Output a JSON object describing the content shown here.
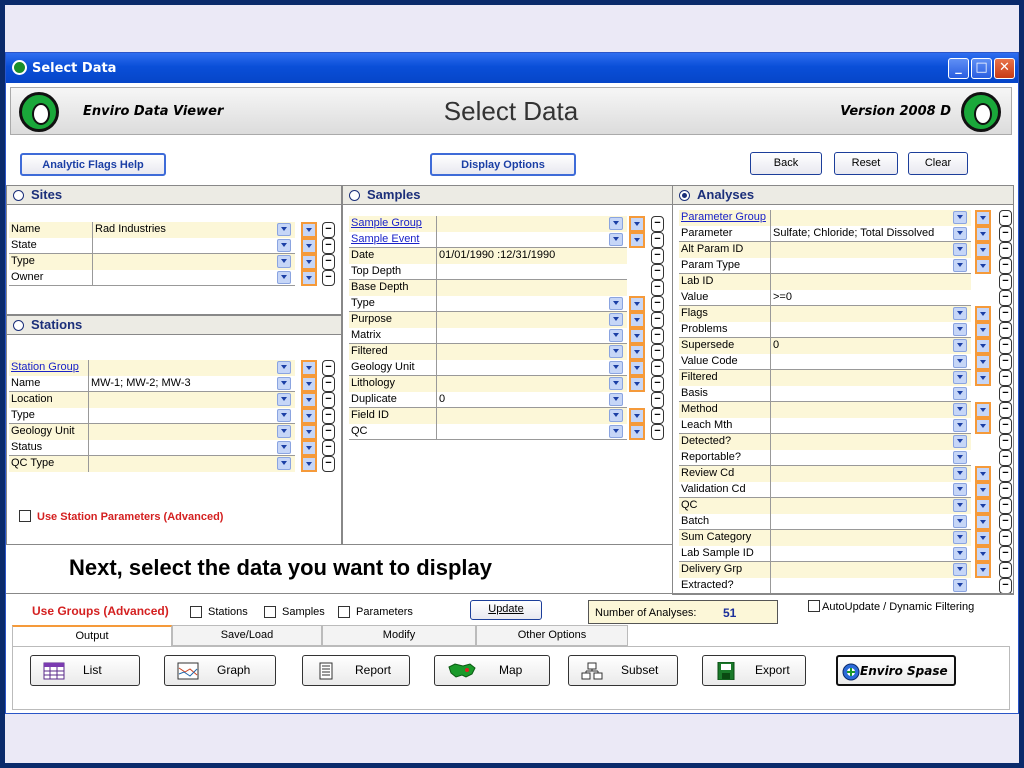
{
  "window": {
    "title": "Select Data"
  },
  "header": {
    "brand": "Enviro Data Viewer",
    "title": "Select Data",
    "version": "Version 2008 D"
  },
  "toolbar": {
    "analytic_flags_help": "Analytic Flags Help",
    "display_options": "Display Options",
    "back": "Back",
    "reset": "Reset",
    "clear": "Clear"
  },
  "sites": {
    "title": "Sites",
    "rows": [
      {
        "label": "Name",
        "value": "Rad Industries"
      },
      {
        "label": "State",
        "value": ""
      },
      {
        "label": "Type",
        "value": ""
      },
      {
        "label": "Owner",
        "value": ""
      }
    ]
  },
  "stations": {
    "title": "Stations",
    "rows": [
      {
        "label": "Station Group",
        "value": "",
        "link": true
      },
      {
        "label": "Name",
        "value": "MW-1; MW-2; MW-3"
      },
      {
        "label": "Location",
        "value": ""
      },
      {
        "label": "Type",
        "value": ""
      },
      {
        "label": "Geology Unit",
        "value": ""
      },
      {
        "label": "Status",
        "value": ""
      },
      {
        "label": "QC Type",
        "value": ""
      }
    ],
    "advanced_label": "Use Station Parameters (Advanced)"
  },
  "samples": {
    "title": "Samples",
    "rows": [
      {
        "label": "Sample Group",
        "value": "",
        "link": true,
        "dd": true,
        "sel": true
      },
      {
        "label": "Sample Event",
        "value": "",
        "link": true,
        "dd": true,
        "sel": true
      },
      {
        "label": "Date",
        "value": "01/01/1990 :12/31/1990",
        "dd": false,
        "sel": false
      },
      {
        "label": "Top Depth",
        "value": "",
        "dd": false,
        "sel": false
      },
      {
        "label": "Base Depth",
        "value": "",
        "dd": false,
        "sel": false
      },
      {
        "label": "Type",
        "value": "",
        "dd": true,
        "sel": true
      },
      {
        "label": "Purpose",
        "value": "",
        "dd": true,
        "sel": true
      },
      {
        "label": "Matrix",
        "value": "",
        "dd": true,
        "sel": true
      },
      {
        "label": "Filtered",
        "value": "",
        "dd": true,
        "sel": true
      },
      {
        "label": "Geology Unit",
        "value": "",
        "dd": true,
        "sel": true
      },
      {
        "label": "Lithology",
        "value": "",
        "dd": true,
        "sel": true
      },
      {
        "label": "Duplicate",
        "value": "0",
        "dd": true,
        "sel": false
      },
      {
        "label": "Field ID",
        "value": "",
        "dd": true,
        "sel": true
      },
      {
        "label": "QC",
        "value": "",
        "dd": true,
        "sel": true
      }
    ]
  },
  "analyses": {
    "title": "Analyses",
    "rows": [
      {
        "label": "Parameter Group",
        "value": "",
        "link": true,
        "dd": true,
        "sel": true
      },
      {
        "label": "Parameter",
        "value": "Sulfate; Chloride; Total Dissolved",
        "dd": true,
        "sel": true
      },
      {
        "label": "Alt Param ID",
        "value": "",
        "dd": true,
        "sel": true
      },
      {
        "label": "Param Type",
        "value": "",
        "dd": true,
        "sel": true
      },
      {
        "label": "Lab ID",
        "value": "",
        "dd": false,
        "sel": false
      },
      {
        "label": "Value",
        "value": ">=0",
        "dd": false,
        "sel": false
      },
      {
        "label": "Flags",
        "value": "",
        "dd": true,
        "sel": true
      },
      {
        "label": "Problems",
        "value": "",
        "dd": true,
        "sel": true
      },
      {
        "label": "Supersede",
        "value": "0",
        "dd": true,
        "sel": true
      },
      {
        "label": "Value Code",
        "value": "",
        "dd": true,
        "sel": true
      },
      {
        "label": "Filtered",
        "value": "",
        "dd": true,
        "sel": true
      },
      {
        "label": "Basis",
        "value": "",
        "dd": true,
        "sel": false
      },
      {
        "label": "Method",
        "value": "",
        "dd": true,
        "sel": true
      },
      {
        "label": "Leach Mth",
        "value": "",
        "dd": true,
        "sel": true
      },
      {
        "label": "Detected?",
        "value": "",
        "dd": true,
        "sel": false
      },
      {
        "label": "Reportable?",
        "value": "",
        "dd": true,
        "sel": false
      },
      {
        "label": "Review Cd",
        "value": "",
        "dd": true,
        "sel": true
      },
      {
        "label": "Validation Cd",
        "value": "",
        "dd": true,
        "sel": true
      },
      {
        "label": "QC",
        "value": "",
        "dd": true,
        "sel": true
      },
      {
        "label": "Batch",
        "value": "",
        "dd": true,
        "sel": true
      },
      {
        "label": "Sum Category",
        "value": "",
        "dd": true,
        "sel": true
      },
      {
        "label": "Lab Sample ID",
        "value": "",
        "dd": true,
        "sel": true
      },
      {
        "label": "Delivery Grp",
        "value": "",
        "dd": true,
        "sel": true
      },
      {
        "label": "Extracted?",
        "value": "",
        "dd": true,
        "sel": false
      }
    ]
  },
  "caption": "Next, select the data you want to display",
  "groups": {
    "label": "Use Groups (Advanced)",
    "stations": "Stations",
    "samples": "Samples",
    "parameters": "Parameters",
    "update": "Update",
    "count_label": "Number of Analyses:",
    "count": "51",
    "auto_update": "AutoUpdate / Dynamic Filtering"
  },
  "tabs": [
    "Output",
    "Save/Load",
    "Modify",
    "Other Options"
  ],
  "output_buttons": [
    {
      "label": "List",
      "icon": "list-icon"
    },
    {
      "label": "Graph",
      "icon": "graph-icon"
    },
    {
      "label": "Report",
      "icon": "report-icon"
    },
    {
      "label": "Map",
      "icon": "map-icon"
    },
    {
      "label": "Subset",
      "icon": "subset-icon"
    },
    {
      "label": "Export",
      "icon": "export-icon"
    },
    {
      "label": "Enviro Spase",
      "icon": "enviro-spase-icon"
    }
  ]
}
